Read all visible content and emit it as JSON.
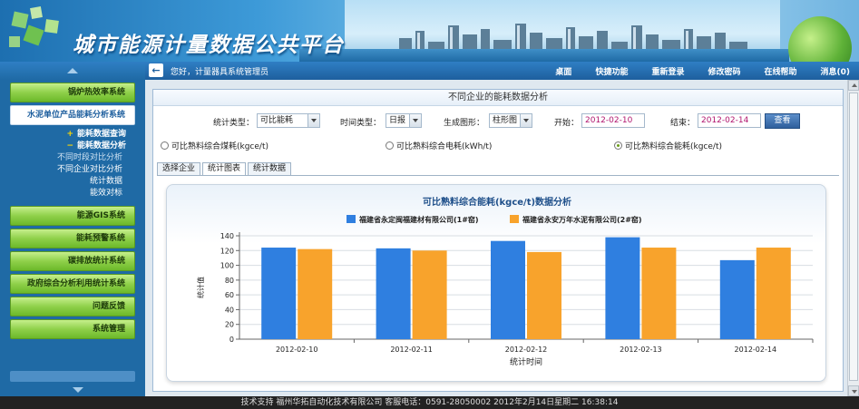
{
  "header": {
    "title": "城市能源计量数据公共平台"
  },
  "navbar": {
    "welcome": "您好，计量器具系统管理员",
    "links": [
      "桌面",
      "快捷功能",
      "重新登录",
      "修改密码",
      "在线帮助",
      "消息(0)"
    ]
  },
  "sidebar": {
    "menu_top": [
      "锅炉热效率系统",
      "水泥单位产品能耗分析系统"
    ],
    "submenu": {
      "expand1": "能耗数据查询",
      "expand2": "能耗数据分析",
      "children": [
        "不同时段对比分析",
        "不同企业对比分析",
        "统计数据",
        "能效对标"
      ]
    },
    "menu_bottom": [
      "能源GIS系统",
      "能耗预警系统",
      "碳排放统计系统",
      "政府综合分析利用统计系统",
      "问题反馈",
      "系统管理"
    ]
  },
  "panel": {
    "title": "不同企业的能耗数据分析",
    "filters": {
      "stat_type_label": "统计类型：",
      "stat_type_value": "可比能耗",
      "time_type_label": "时间类型：",
      "time_type_value": "日报",
      "chart_type_label": "生成图形：",
      "chart_type_value": "柱形图",
      "start_label": "开始：",
      "start_value": "2012-02-10",
      "end_label": "结束：",
      "end_value": "2012-02-14",
      "view_button": "查看"
    },
    "radios": [
      {
        "label": "可比熟料综合煤耗(kgce/t)",
        "checked": false
      },
      {
        "label": "可比熟料综合电耗(kWh/t)",
        "checked": false
      },
      {
        "label": "可比熟料综合能耗(kgce/t)",
        "checked": true
      }
    ],
    "tabs": [
      "选择企业",
      "统计图表",
      "统计数据"
    ],
    "active_tab": 1
  },
  "chart_data": {
    "type": "bar",
    "title": "可比熟料综合能耗(kgce/t)数据分析",
    "xlabel": "统计时间",
    "ylabel": "统计值",
    "ylim": [
      0,
      140
    ],
    "yticks": [
      0,
      20,
      40,
      60,
      80,
      100,
      120,
      140
    ],
    "categories": [
      "2012-02-10",
      "2012-02-11",
      "2012-02-12",
      "2012-02-13",
      "2012-02-14"
    ],
    "series": [
      {
        "name": "福建省永定闽福建材有限公司(1#窑)",
        "color": "#2f7fe0",
        "values": [
          124,
          123,
          133,
          138,
          107
        ]
      },
      {
        "name": "福建省永安万年水泥有限公司(2#窑)",
        "color": "#f8a32c",
        "values": [
          122,
          120,
          118,
          124,
          124
        ]
      }
    ],
    "legend": "top",
    "grid": true
  },
  "footer": {
    "text": "技术支持 福州华拓自动化技术有限公司 客服电话：0591-28050002 2012年2月14日星期二 16:38:14"
  }
}
